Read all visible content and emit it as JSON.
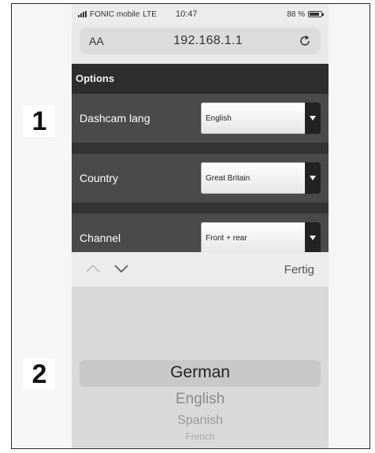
{
  "status_bar": {
    "carrier": "FONIC mobile",
    "network": "LTE",
    "time": "10:47",
    "battery": "88 %",
    "battery_level": 0.88
  },
  "url_bar": {
    "text_size_label": "AA",
    "url": "192.168.1.1"
  },
  "options": {
    "header": "Options",
    "rows": [
      {
        "label": "Dashcam lang",
        "value": "English"
      },
      {
        "label": "Country",
        "value": "Great Britain"
      },
      {
        "label": "Channel",
        "value": "Front + rear"
      }
    ]
  },
  "picker": {
    "done_label": "Fertig",
    "options": [
      "German",
      "English",
      "Spanish",
      "French"
    ],
    "selected": "German"
  },
  "callouts": [
    "1",
    "2"
  ],
  "colors": {
    "panel_dark": "#2d2d2d",
    "row_gray": "#4a4a4a",
    "picker_bg": "#d9d9d9"
  },
  "icons": [
    "signal-icon",
    "battery-icon",
    "reload-icon",
    "dropdown-arrow-icon",
    "chevron-up-icon",
    "chevron-down-icon"
  ]
}
